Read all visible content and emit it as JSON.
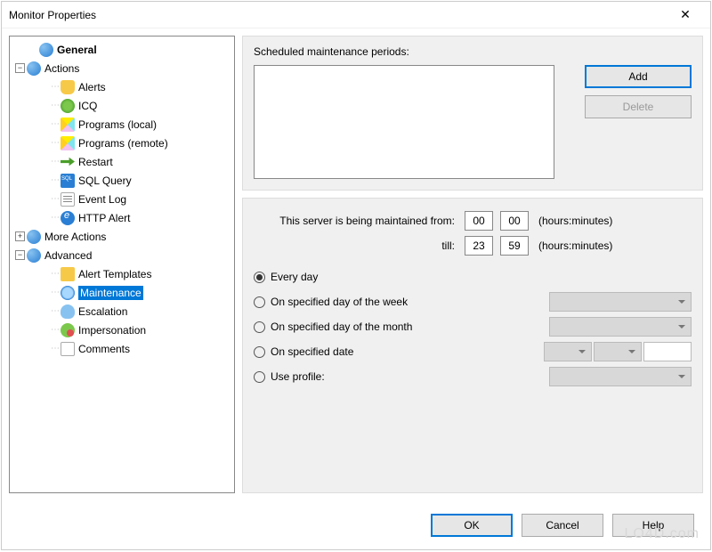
{
  "window": {
    "title": "Monitor Properties"
  },
  "tree": {
    "general": "General",
    "actions": "Actions",
    "alerts": "Alerts",
    "icq": "ICQ",
    "programs_local": "Programs (local)",
    "programs_remote": "Programs (remote)",
    "restart": "Restart",
    "sql_query": "SQL Query",
    "event_log": "Event Log",
    "http_alert": "HTTP Alert",
    "more_actions": "More Actions",
    "advanced": "Advanced",
    "alert_templates": "Alert Templates",
    "maintenance": "Maintenance",
    "escalation": "Escalation",
    "impersonation": "Impersonation",
    "comments": "Comments"
  },
  "panel": {
    "scheduled_label": "Scheduled maintenance periods:",
    "add": "Add",
    "delete": "Delete",
    "maintained_from": "This server is being maintained from:",
    "till": "till:",
    "from_h": "00",
    "from_m": "00",
    "till_h": "23",
    "till_m": "59",
    "unit": "(hours:minutes)",
    "opt_every_day": "Every day",
    "opt_day_week": "On specified day of the week",
    "opt_day_month": "On specified day of the month",
    "opt_date": "On specified date",
    "opt_profile": "Use profile:",
    "selected_option": "every_day"
  },
  "buttons": {
    "ok": "OK",
    "cancel": "Cancel",
    "help": "Help"
  },
  "watermark": "LO4D.com"
}
